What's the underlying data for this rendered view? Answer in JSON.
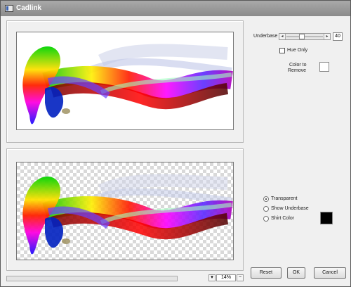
{
  "window": {
    "title": "Cadlink"
  },
  "controls": {
    "underbase_label": "Underbase",
    "underbase_value": "40",
    "underbase_slider_level": 0.4,
    "hue_only_label": "Hue Only",
    "hue_only_checked": false,
    "color_to_remove_label": [
      "Color to",
      "Remove"
    ],
    "color_to_remove_swatch": "#ffffff",
    "radios": [
      {
        "label": "Transparent",
        "checked": true
      },
      {
        "label": "Show Underbase",
        "checked": false
      },
      {
        "label": "Shirt Color",
        "checked": false
      }
    ],
    "shirt_color_swatch": "#000000"
  },
  "bottom": {
    "zoom_value": "14%",
    "zoom_down": "▾",
    "zoom_up": "−"
  },
  "buttons": {
    "reset": "Reset",
    "ok": "OK",
    "cancel": "Cancel"
  },
  "icons": {
    "window_icon": "app-window-icon",
    "slider_left": "◂",
    "slider_right": "▸"
  }
}
